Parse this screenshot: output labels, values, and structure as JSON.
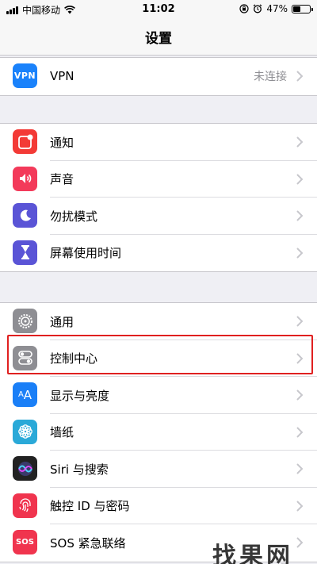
{
  "status": {
    "carrier": "中国移动",
    "time": "11:02",
    "battery": "47%",
    "battery_level": 0.47
  },
  "nav": {
    "title": "设置"
  },
  "groups": [
    {
      "items": [
        {
          "label": "VPN",
          "value": "未连接",
          "icon": "vpn-icon",
          "color": "#1a82fb"
        }
      ]
    },
    {
      "items": [
        {
          "label": "通知",
          "icon": "notifications-icon",
          "color": "#f33a36"
        },
        {
          "label": "声音",
          "icon": "speaker-icon",
          "color": "#f33a5a"
        },
        {
          "label": "勿扰模式",
          "icon": "moon-icon",
          "color": "#5a54d6"
        },
        {
          "label": "屏幕使用时间",
          "icon": "hourglass-icon",
          "color": "#5a54d6"
        }
      ]
    },
    {
      "items": [
        {
          "label": "通用",
          "icon": "gear-icon",
          "color": "#8e8e93"
        },
        {
          "label": "控制中心",
          "icon": "toggles-icon",
          "color": "#8e8e93"
        },
        {
          "label": "显示与亮度",
          "icon": "text-size-icon",
          "color": "#1a7ff7"
        },
        {
          "label": "墙纸",
          "icon": "flower-icon",
          "color": "#2aa9d8"
        },
        {
          "label": "Siri 与搜索",
          "icon": "siri-icon",
          "color": "#222222"
        },
        {
          "label": "触控 ID 与密码",
          "icon": "fingerprint-icon",
          "color": "#f0344e"
        },
        {
          "label": "SOS 紧急联络",
          "icon": "sos-icon",
          "color": "#f0344e",
          "icon_text": "SOS"
        }
      ]
    }
  ],
  "watermark": {
    "text": "找果网",
    "sub": ""
  }
}
